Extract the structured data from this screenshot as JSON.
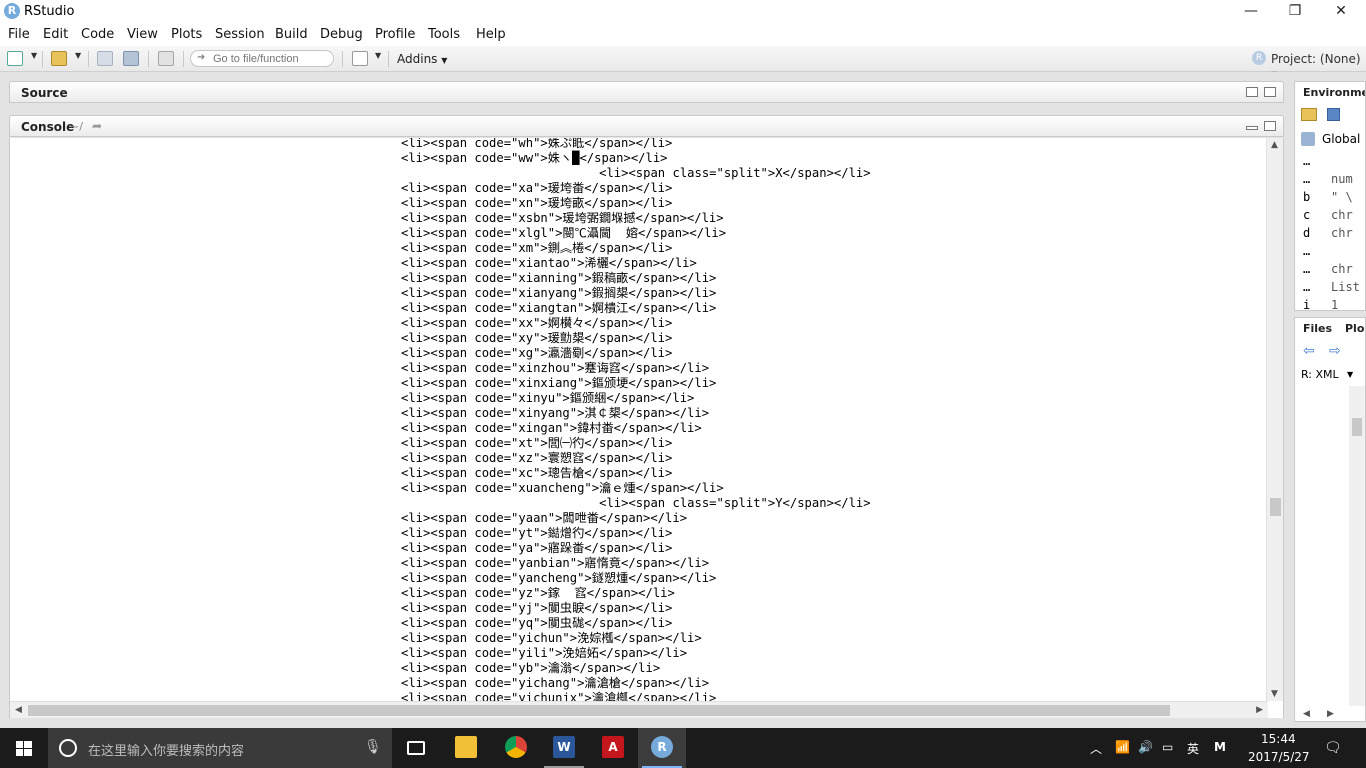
{
  "window": {
    "title": "RStudio",
    "minimize": "—",
    "maximize": "❐",
    "close": "✕"
  },
  "menu": [
    "File",
    "Edit",
    "Code",
    "View",
    "Plots",
    "Session",
    "Build",
    "Debug",
    "Profile",
    "Tools",
    "Help"
  ],
  "toolbar": {
    "goto_placeholder": "Go to file/function",
    "addins_label": "Addins",
    "project_label": "Project: (None)"
  },
  "source_pane": {
    "title": "Source"
  },
  "console_pane": {
    "title": "Console",
    "path": "~/",
    "lines": [
      "<li><span code=\"wh\">姝ぷ眡</span></li>",
      "<li><span code=\"ww\">姝ヽ█</span></li>",
      "                           <li><span class=\"split\">X</span></li>",
      "<li><span code=\"xa\">瑗垮畨</span></li>",
      "<li><span code=\"xn\">瑗垮畞</span></li>",
      "<li><span code=\"xsbn\">瑗垮弻鐗堢撼</span></li>",
      "<li><span code=\"xlgl\">閿℃灄閫  嫆</span></li>",
      "<li><span code=\"xm\">鍘︽棬</span></li>",
      "<li><span code=\"xiantao\">浠欐</span></li>",
      "<li><span code=\"xianning\">鍜稿畞</span></li>",
      "<li><span code=\"xianyang\">鍜搁槼</span></li>",
      "<li><span code=\"xiangtan\">婀樻江</span></li>",
      "<li><span code=\"xx\">婀櫕々</span></li>",
      "<li><span code=\"xy\">瑗勯槼</span></li>",
      "<li><span code=\"xg\">瀛濇劅</span></li>",
      "<li><span code=\"xinzhou\">蹇诲窞</span></li>",
      "<li><span code=\"xinxiang\">鏂颁埂</span></li>",
      "<li><span code=\"xinyu\">鏂颁綑</span></li>",
      "<li><span code=\"xinyang\">淇￠槼</span></li>",
      "<li><span code=\"xingan\">鍏村畨</span></li>",
      "<li><span code=\"xt\">閭㈠彴</span></li>",
      "<li><span code=\"xz\">寰愬窞</span></li>",
      "<li><span code=\"xc\">璁告槍</span></li>",
      "<li><span code=\"xuancheng\">瀹ｅ煄</span></li>",
      "                           <li><span class=\"split\">Y</span></li>",
      "<li><span code=\"yaan\">闆呭畨</span></li>",
      "<li><span code=\"yt\">鐑熷彴</span></li>",
      "<li><span code=\"ya\">寤跺畨</span></li>",
      "<li><span code=\"yanbian\">寤惰竟</span></li>",
      "<li><span code=\"yancheng\">鐩愬煄</span></li>",
      "<li><span code=\"yz\">鎵  窞</span></li>",
      "<li><span code=\"yj\">闃虫睙</span></li>",
      "<li><span code=\"yq\">闃虫硥</span></li>",
      "<li><span code=\"yichun\">浼婃槬</span></li>",
      "<li><span code=\"yili\">浼婄妬</span></li>",
      "<li><span code=\"yb\">瀹滃</span></li>",
      "<li><span code=\"yichang\">瀹滄槍</span></li>",
      "<li><span code=\"yichunjx\">瀹滄槬</span></li>"
    ]
  },
  "environment_pane": {
    "tab": "Environme",
    "scope": "Global",
    "rows": [
      {
        "name": "…",
        "value": ""
      },
      {
        "name": "…",
        "value": "num"
      },
      {
        "name": "b",
        "value": "\" \\"
      },
      {
        "name": "c",
        "value": "chr"
      },
      {
        "name": "d",
        "value": "chr"
      },
      {
        "name": "…",
        "value": ""
      },
      {
        "name": "…",
        "value": "chr"
      },
      {
        "name": "…",
        "value": "List"
      },
      {
        "name": "i",
        "value": "1"
      }
    ]
  },
  "files_pane": {
    "tab1": "Files",
    "tab2": "Plo",
    "language": "R: XML"
  },
  "taskbar": {
    "search_placeholder": "在这里输入你要搜索的内容",
    "ime_label": "英",
    "ime_mode": "M",
    "time": "15:44",
    "date": "2017/5/27"
  }
}
